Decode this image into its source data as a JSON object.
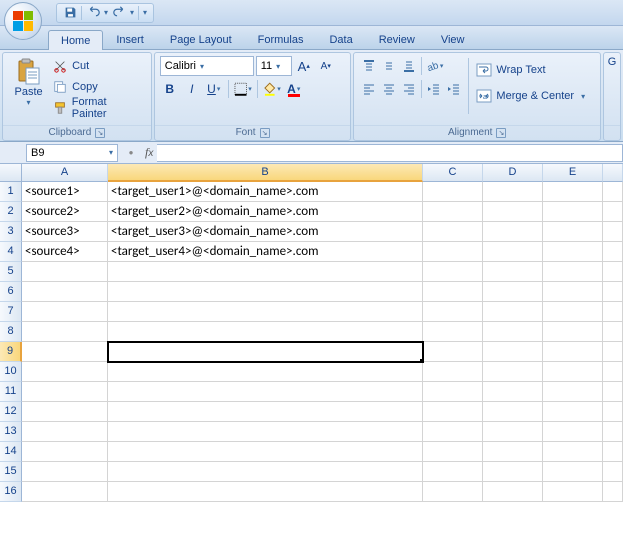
{
  "qat": {
    "save": "save-icon",
    "undo": "undo-icon",
    "redo": "redo-icon"
  },
  "tabs": [
    "Home",
    "Insert",
    "Page Layout",
    "Formulas",
    "Data",
    "Review",
    "View"
  ],
  "active_tab": 0,
  "clipboard": {
    "paste": "Paste",
    "cut": "Cut",
    "copy": "Copy",
    "format_painter": "Format Painter",
    "label": "Clipboard"
  },
  "font": {
    "name": "Calibri",
    "size": "11",
    "label": "Font"
  },
  "alignment": {
    "wrap": "Wrap Text",
    "merge": "Merge & Center",
    "label": "Alignment"
  },
  "namebox": "B9",
  "columns": [
    "A",
    "B",
    "C",
    "D",
    "E"
  ],
  "rows": [
    "1",
    "2",
    "3",
    "4",
    "5",
    "6",
    "7",
    "8",
    "9",
    "10",
    "11",
    "12",
    "13",
    "14",
    "15",
    "16"
  ],
  "active_cell": {
    "row": 9,
    "col": "B"
  },
  "cells": {
    "A1": "<source1>",
    "B1": "<target_user1>@<domain_name>.com",
    "A2": "<source2>",
    "B2": "<target_user2>@<domain_name>.com",
    "A3": "<source3>",
    "B3": "<target_user3>@<domain_name>.com",
    "A4": "<source4>",
    "B4": "<target_user4>@<domain_name>.com"
  },
  "extra_group_initial": "G"
}
